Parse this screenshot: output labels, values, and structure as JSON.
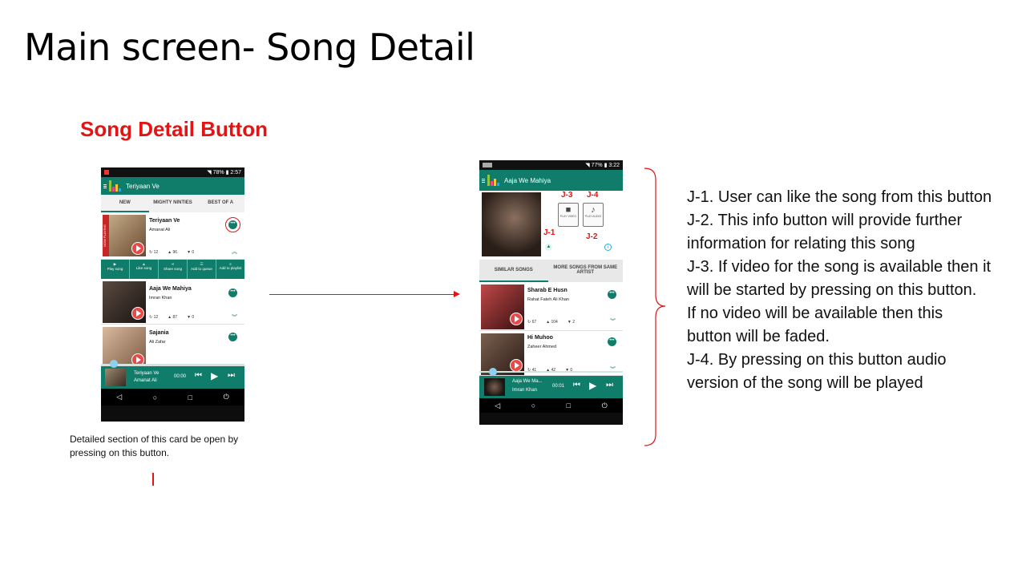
{
  "slide": {
    "title": "Main screen- Song Detail",
    "section_title": "Song Detail Button",
    "caption": "Detailed section of this card be open by pressing on this button.",
    "accent_color": "#0f7d6a",
    "annotation_color": "#e31414"
  },
  "phone1": {
    "status": {
      "battery": "78%",
      "time": "2:57"
    },
    "appbar_title": "Teriyaan Ve",
    "tabs": [
      "NEW",
      "MIGHTY NINTIES",
      "BEST OF A"
    ],
    "now_playing_ribbon": "NOW PLAYING",
    "songs": [
      {
        "title": "Teriyaan Ve",
        "artist": "Amanat Ali",
        "plays": "12",
        "likes": "96",
        "dislikes": "0"
      },
      {
        "title": "Aaja We Mahiya",
        "artist": "Imran Khan",
        "plays": "12",
        "likes": "87",
        "dislikes": "0"
      },
      {
        "title": "Sajania",
        "artist": "Ali Zafar"
      }
    ],
    "actions": [
      "Play song",
      "Like song",
      "Share song",
      "Add to queue",
      "Add to playlist"
    ],
    "player": {
      "title": "Teriyaan Ve",
      "artist": "Amanat Ali",
      "time": "00:00"
    }
  },
  "phone2": {
    "status": {
      "battery": "77%",
      "time": "3:22"
    },
    "appbar_title": "Aaja We Mahiya",
    "media_buttons": {
      "video": "PLAY VIDEO",
      "audio": "PLAY AUDIO"
    },
    "labels": {
      "j1": "J-1",
      "j2": "J-2",
      "j3": "J-3",
      "j4": "J-4"
    },
    "tabs": [
      "SIMILAR SONGS",
      "MORE SONGS FROM SAME ARTIST"
    ],
    "songs": [
      {
        "title": "Sharab E Husn",
        "artist": "Rahat Fateh Ali Khan",
        "plays": "67",
        "likes": "104",
        "dislikes": "2"
      },
      {
        "title": "Hi Muhoo",
        "artist": "Zaheer Ahmed",
        "plays": "41",
        "likes": "42",
        "dislikes": "0"
      }
    ],
    "player": {
      "title": "Aaja We Ma...",
      "artist": "Imran Khan",
      "time": "00:01"
    }
  },
  "notes": [
    "J-1. User can like the song from this button",
    "J-2. This info button will provide further",
    "information for relating this song",
    "J-3. If video for the song is available then it",
    "will be started by pressing on this button.",
    "If no video will be available then this",
    "button will be faded.",
    "J-4. By pressing on this button audio",
    "version of the song will be played"
  ]
}
